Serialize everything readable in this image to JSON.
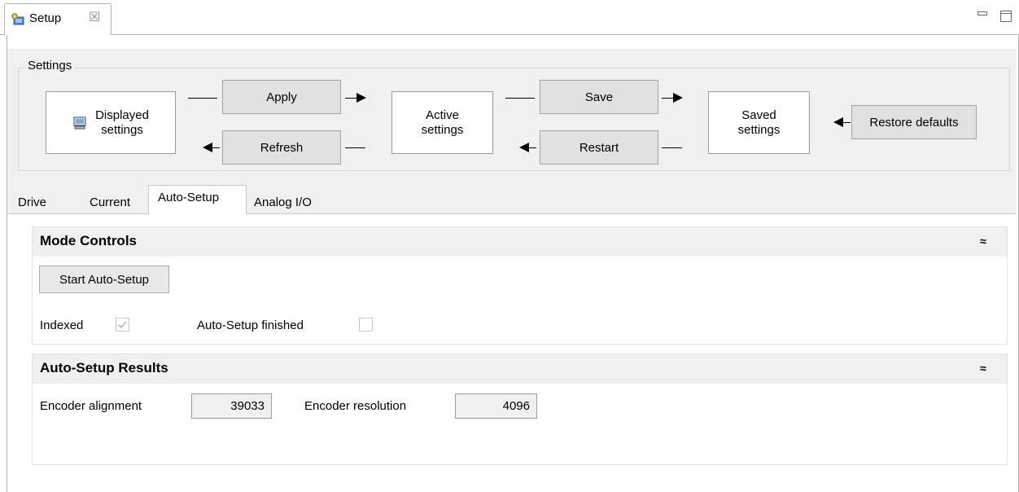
{
  "view": {
    "tab_label": "Setup",
    "close_glyph": "☒",
    "icon": "setup-icon"
  },
  "settings": {
    "group_label": "Settings",
    "displayed": {
      "line1": "Displayed",
      "line2": "settings"
    },
    "active": {
      "line1": "Active",
      "line2": "settings"
    },
    "saved": {
      "line1": "Saved",
      "line2": "settings"
    },
    "apply_label": "Apply",
    "refresh_label": "Refresh",
    "save_label": "Save",
    "restart_label": "Restart",
    "restore_label": "Restore defaults"
  },
  "tabs": [
    {
      "label": "Drive"
    },
    {
      "label": "Current"
    },
    {
      "label": "Auto-Setup",
      "selected": true
    },
    {
      "label": "Analog I/O"
    }
  ],
  "mode_controls": {
    "title": "Mode Controls",
    "start_button": "Start Auto-Setup",
    "indexed_label": "Indexed",
    "indexed_checked": true,
    "finished_label": "Auto-Setup finished",
    "finished_checked": false
  },
  "results": {
    "title": "Auto-Setup Results",
    "alignment_label": "Encoder alignment",
    "alignment_value": "39033",
    "resolution_label": "Encoder resolution",
    "resolution_value": "4096"
  },
  "collapse_glyph": "≈",
  "colors": {
    "panel_bg": "#f0f0f0",
    "border": "#a9b7c9",
    "button_bg": "#e1e1e1"
  }
}
